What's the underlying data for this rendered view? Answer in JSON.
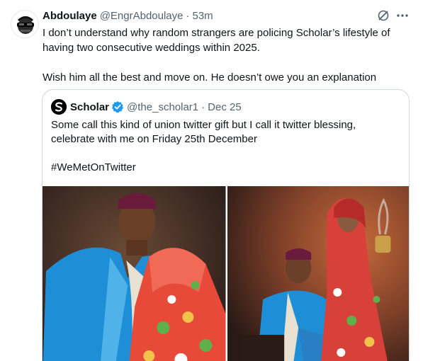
{
  "tweet": {
    "display_name": "Abdoulaye",
    "handle": "@EngrAbdoulaye",
    "separator": "·",
    "time": "53m",
    "text_line1": "I don’t understand why random strangers are policing Scholar’s lifestyle of having two consecutive weddings within 2025.",
    "text_line2": "Wish him all the best and move on. He doesn’t owe you an explanation",
    "avatar_icon": "masked-face-avatar",
    "actions": {
      "grok_icon": "grok-icon",
      "more_icon": "more-horizontal-icon"
    }
  },
  "quote": {
    "display_name": "Scholar",
    "handle": "@the_scholar1",
    "separator": "·",
    "date": "Dec 25",
    "verified_color": "#1d9bf0",
    "text_line1": "Some call this kind of union twitter gift but I call it twitter blessing, celebrate with me on Friday 25th December",
    "hashtag": "#WeMetOnTwitter",
    "photos": [
      {
        "name": "couple-facing-photo"
      },
      {
        "name": "couple-seated-photo"
      }
    ]
  },
  "colors": {
    "text": "#0f1419",
    "secondary": "#536471",
    "border": "#cfd9de",
    "accent": "#1d9bf0"
  }
}
